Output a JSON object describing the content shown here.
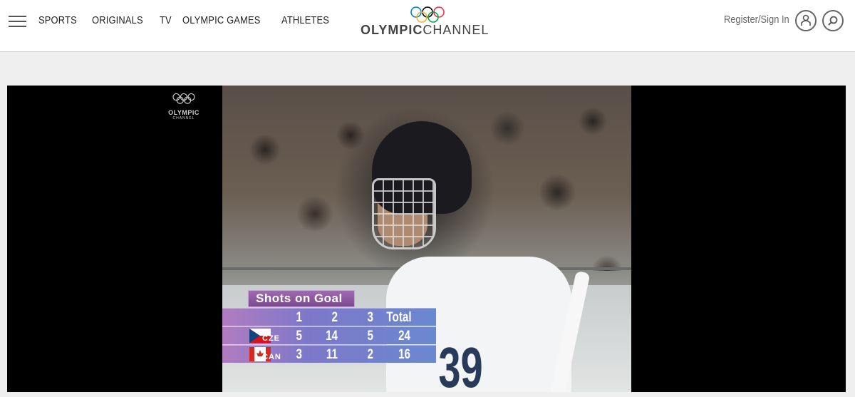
{
  "header": {
    "menu_icon": "hamburger-menu-icon",
    "nav": [
      "SPORTS",
      "ORIGINALS",
      "TV",
      "OLYMPIC GAMES",
      "ATHLETES"
    ],
    "logo": {
      "bold": "OLYMPIC",
      "light": "CHANNEL"
    },
    "auth_label": "Register/Sign In",
    "user_icon": "user-icon",
    "search_icon": "search-icon"
  },
  "video": {
    "watermark": {
      "line1": "OLYMPIC",
      "line2": "CHANNEL"
    },
    "jersey_number": "39",
    "scoreboard": {
      "title": "Shots on Goal",
      "headers": [
        "1",
        "2",
        "3",
        "Total"
      ],
      "rows": [
        {
          "code": "CZE",
          "values": [
            "5",
            "14",
            "5",
            "24"
          ]
        },
        {
          "code": "CAN",
          "values": [
            "3",
            "11",
            "2",
            "16"
          ]
        }
      ]
    }
  },
  "colors": {
    "ring_blue": "#0081c8",
    "ring_yellow": "#fcb131",
    "ring_black": "#000000",
    "ring_green": "#00a651",
    "ring_red": "#ee334e"
  }
}
